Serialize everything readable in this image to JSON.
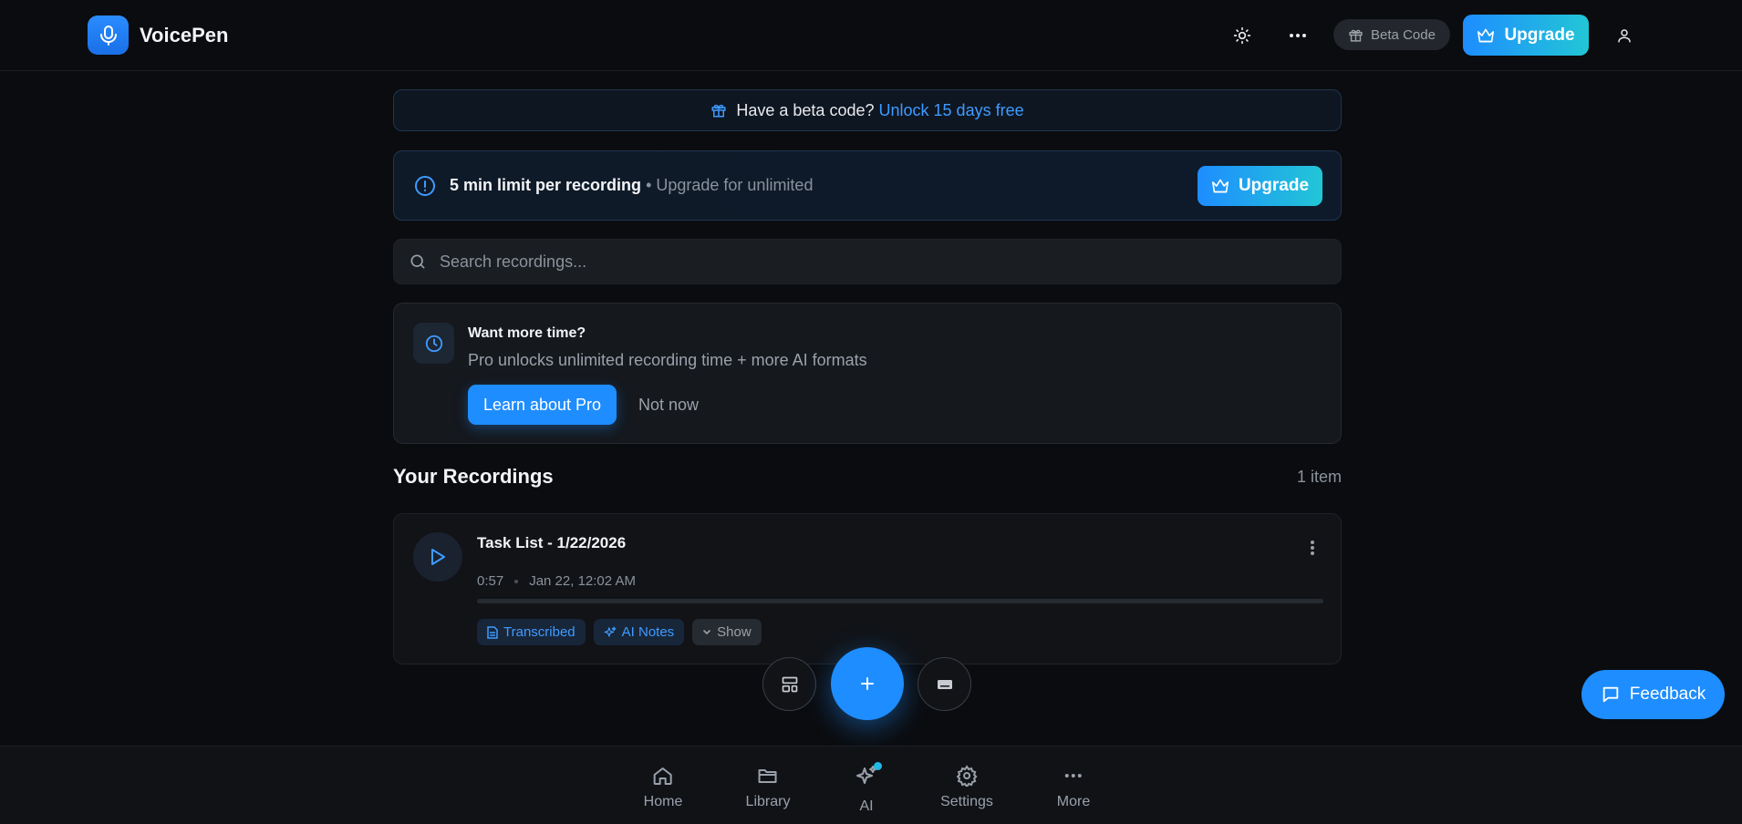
{
  "app": {
    "name": "VoicePen"
  },
  "header": {
    "beta_code_label": "Beta Code",
    "upgrade_label": "Upgrade"
  },
  "beta_banner": {
    "text": "Have a beta code?",
    "link": "Unlock 15 days free"
  },
  "limit_notice": {
    "title": "5 min limit per recording",
    "subtitle": "• Upgrade for unlimited",
    "upgrade_label": "Upgrade"
  },
  "search": {
    "placeholder": "Search recordings..."
  },
  "promo": {
    "title": "Want more time?",
    "description": "Pro unlocks unlimited recording time + more AI formats",
    "primary_label": "Learn about Pro",
    "secondary_label": "Not now"
  },
  "recordings": {
    "heading": "Your Recordings",
    "count": "1 item",
    "items": [
      {
        "title": "Task List - 1/22/2026",
        "duration": "0:57",
        "date": "Jan 22, 12:02 AM",
        "progress": 0,
        "chips": [
          "Transcribed",
          "AI Notes",
          "Show"
        ]
      }
    ]
  },
  "feedback": {
    "label": "Feedback"
  },
  "nav": {
    "items": [
      {
        "label": "Home"
      },
      {
        "label": "Library"
      },
      {
        "label": "AI"
      },
      {
        "label": "Settings"
      },
      {
        "label": "More"
      }
    ]
  },
  "colors": {
    "accent": "#1e8dff",
    "accent_gradient_end": "#22c6d6",
    "background": "#0b0c0f"
  }
}
